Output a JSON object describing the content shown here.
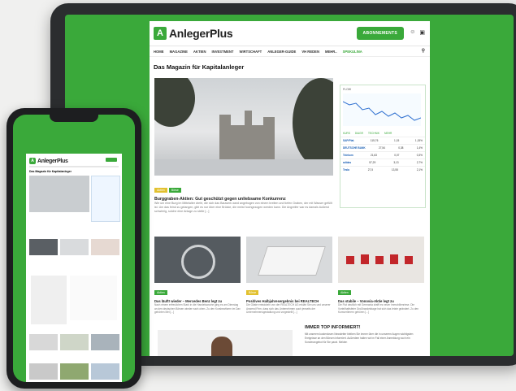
{
  "site": {
    "logo_mark": "A",
    "logo_text": "AnlegerPlus",
    "subscribe_label": "ABONNEMENTS",
    "user_icon": "user-icon",
    "lock_icon": "lock-icon",
    "nav": [
      "HOME",
      "MAGAZINE",
      "AKTIEN",
      "INVESTMENT",
      "WIRTSCHAFT",
      "ANLEGER-GUIDE",
      "VH REDEN",
      "MEHR..",
      "SPEKULINA"
    ],
    "search_icon": "search-icon",
    "headline": "Das Magazin für Kapitalanleger"
  },
  "hero": {
    "tags": [
      "Aktien",
      "Börse"
    ],
    "title": "Burggraben-Aktien: Gut geschützt gegen unliebsame Konkurrenz",
    "text": "Wie um eine Burg im Mittelalter dreht, die sich das Bauwerk ward angebogen von einem breiten und tiefen Graben, der mit Wasser gefüllt ist. Um das feind zu gelangen, gibt es nur über eine Brücke, die meist hochgezogen werden kann. Die Angreifer war es damals äußerst schwierig, solche eine Anlage zu stelle [...]"
  },
  "widget": {
    "title": "FLOW",
    "tabs": [
      "KURS",
      "DIAGR",
      "TECHNIK",
      "MEHR"
    ],
    "rows": [
      {
        "name": "SAP/Plat.",
        "v1": "115,76",
        "v2": "1,15",
        "v3": "1,15%"
      },
      {
        "name": "DEUTSCHE BANK",
        "v1": "27,54",
        "v2": "0,38",
        "v3": "1,4%"
      },
      {
        "name": "Telekom",
        "v1": "21,63",
        "v2": "0,07",
        "v3": "0,3%"
      },
      {
        "name": "adidas",
        "v1": "57,29",
        "v2": "3,13",
        "v3": "2,7%"
      },
      {
        "name": "Tesla",
        "v1": "27,5",
        "v2": "13,55",
        "v3": "2,1%"
      }
    ]
  },
  "cards": [
    {
      "tag": "Aktien",
      "title": "Das läuft! wieder – Mercedes Benz legt zu",
      "text": "Nach einem erfreulichen Stark in die Handelswoche ging es am Dienstag an den deutschen Börsen wieder nach oben. Zu den Kursbewilsern im Dax gehörten Mel [...]"
    },
    {
      "tag": "Börse",
      "title": "Positives Halbjahresergebnis bei REALTECH",
      "text": "Die Gäste entwickeln von der REALTECH AG erklärt Sie uns und unserer Anwend Firm, dass sich das Unternehmen auch jenseits der Unternehmensgestaltung und vorgestellt [...]"
    },
    {
      "tag": "Aktien",
      "title": "Das stabile – Vonovia-Aktie legt zu",
      "text": "Die Flut deutlich mit Germania drafft es neuer Immobilienriese. Die Vorteilhaftsfeier Großhandelstage hat sich das letzte geändert. Zu den Kursverlierern gehören [...]"
    }
  ],
  "newsletter": {
    "title": "IMMER TOP INFORMIERT!",
    "text": "Mit unserem kostenlosen Newsletter bleiben Sie immer über die in unserem Augen wichtigsten Ereignisse an den Börsen informiert. Außerdem halten wir im Fall einer Anmeldung noch ein Sonderangebot für Sie parat. Melden"
  },
  "colors": {
    "brand": "#3aa93a",
    "frame": "#2b2d2f"
  }
}
